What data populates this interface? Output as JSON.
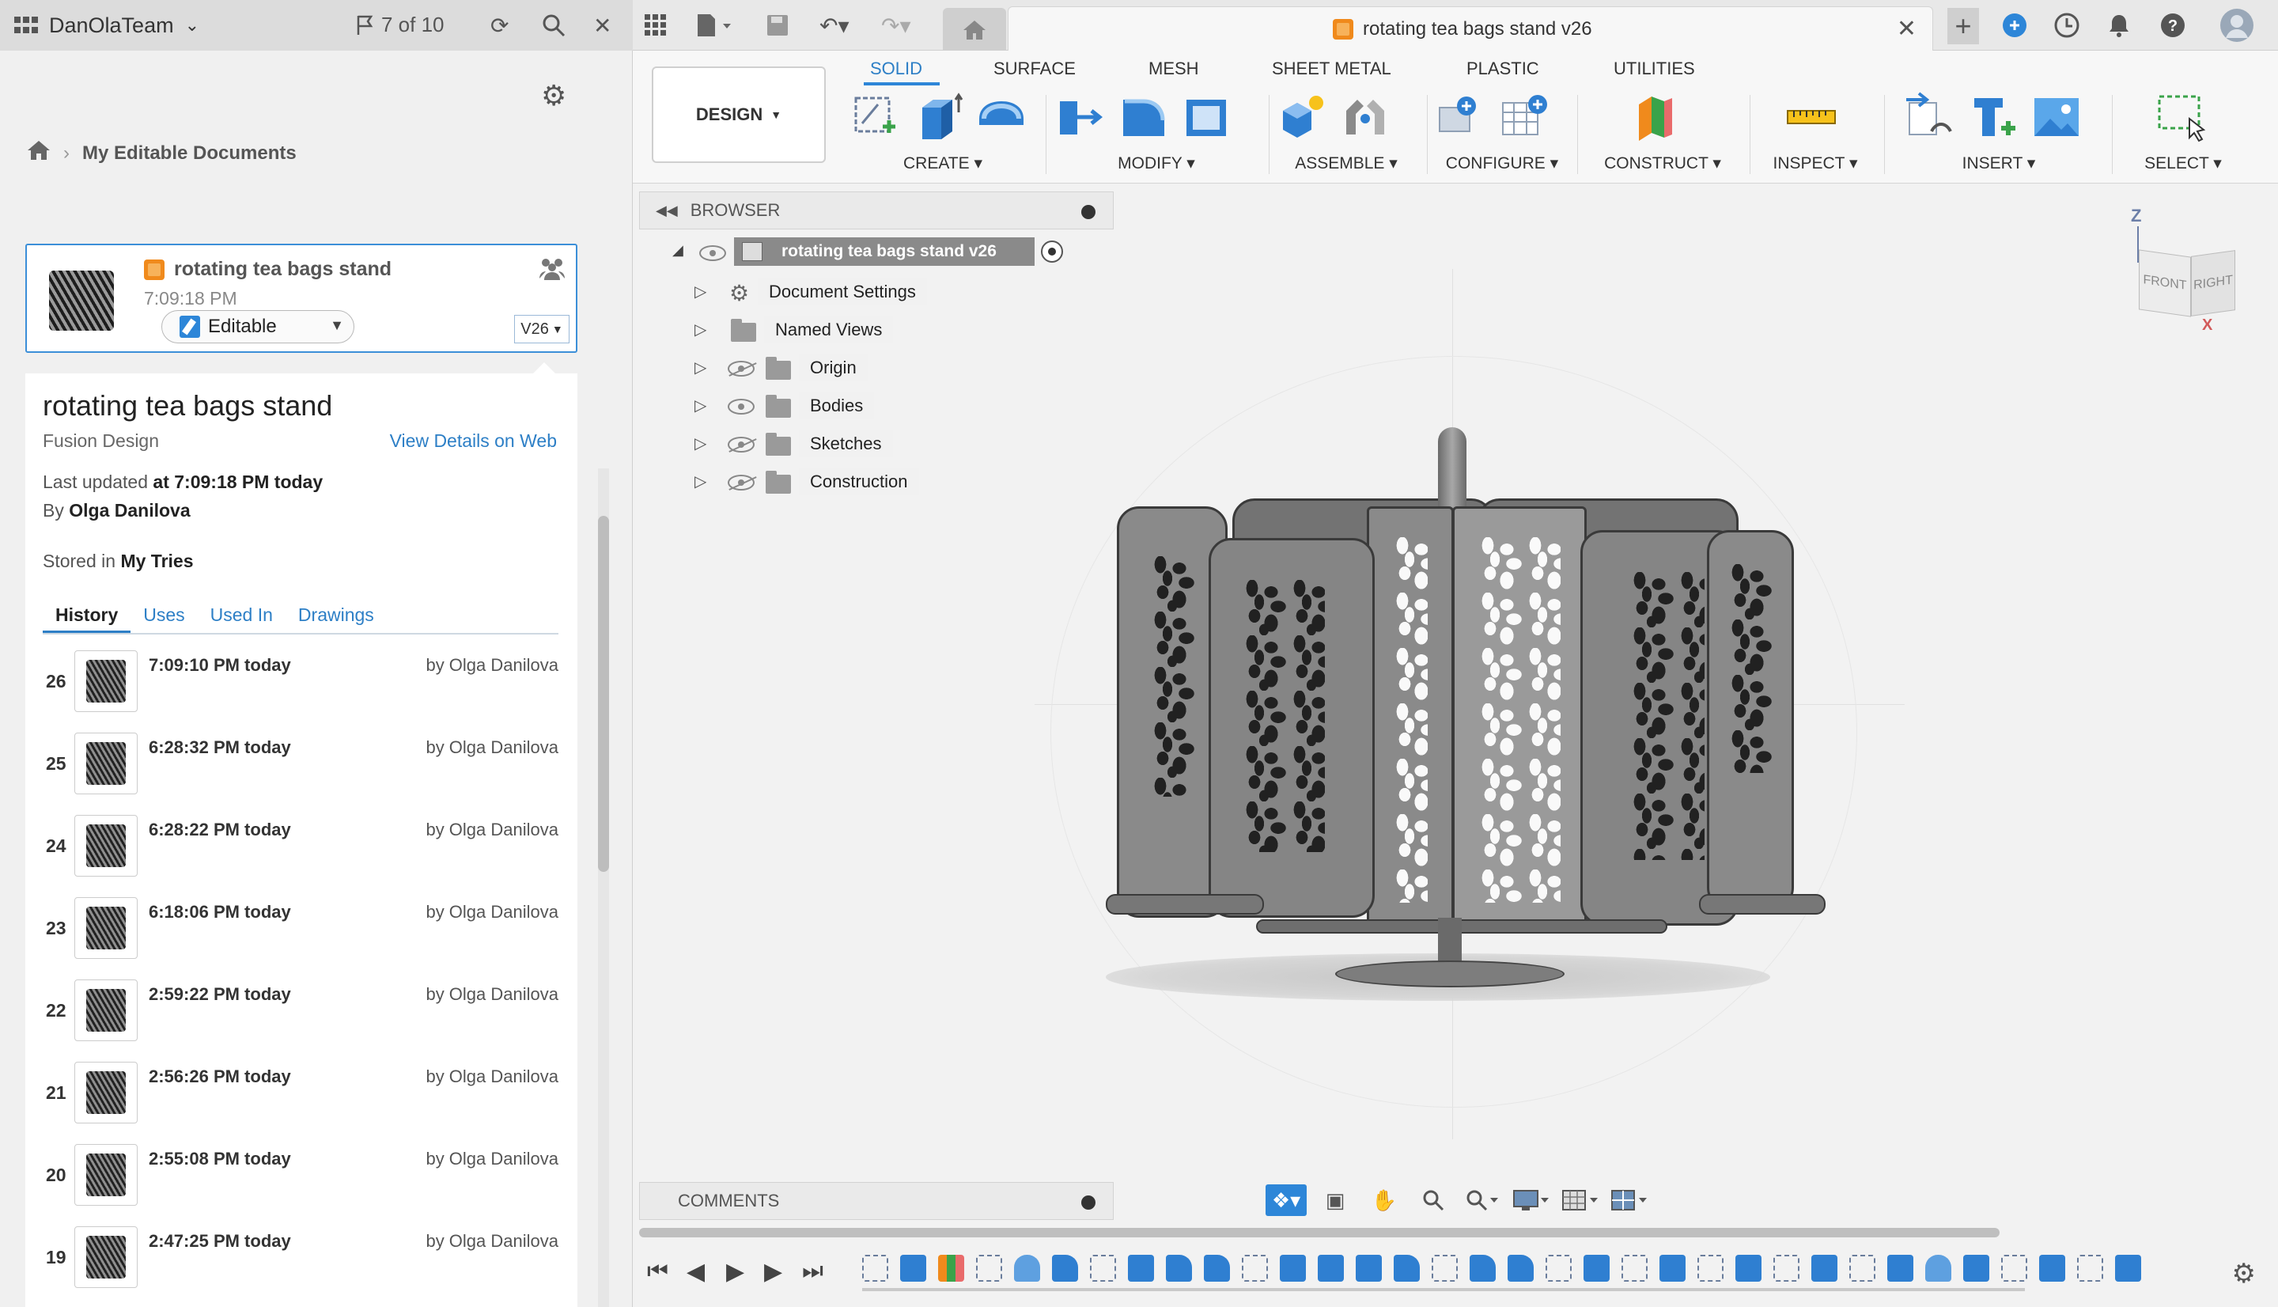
{
  "topbar": {
    "team_name": "DanOlaTeam",
    "jobs_label": "7 of 10",
    "document_tab_title": "rotating tea bags stand v26"
  },
  "data_panel": {
    "breadcrumb": "My Editable Documents",
    "card": {
      "name": "rotating tea bags stand",
      "time": "7:09:18 PM",
      "status": "Editable",
      "version": "V26"
    },
    "details": {
      "title": "rotating tea bags stand",
      "type": "Fusion Design",
      "link": "View Details on Web",
      "updated_prefix": "Last updated ",
      "updated_value": "at 7:09:18 PM today",
      "by_prefix": "By ",
      "by_value": "Olga Danilova",
      "stored_prefix": "Stored in ",
      "stored_value": "My Tries"
    },
    "tabs": [
      "History",
      "Uses",
      "Used In",
      "Drawings"
    ],
    "history": [
      {
        "version": "26",
        "time": "7:09:10 PM today",
        "by": "by Olga Danilova"
      },
      {
        "version": "25",
        "time": "6:28:32 PM today",
        "by": "by Olga Danilova"
      },
      {
        "version": "24",
        "time": "6:28:22 PM today",
        "by": "by Olga Danilova"
      },
      {
        "version": "23",
        "time": "6:18:06 PM today",
        "by": "by Olga Danilova"
      },
      {
        "version": "22",
        "time": "2:59:22 PM today",
        "by": "by Olga Danilova"
      },
      {
        "version": "21",
        "time": "2:56:26 PM today",
        "by": "by Olga Danilova"
      },
      {
        "version": "20",
        "time": "2:55:08 PM today",
        "by": "by Olga Danilova"
      },
      {
        "version": "19",
        "time": "2:47:25 PM today",
        "by": "by Olga Danilova"
      }
    ]
  },
  "toolbar": {
    "workspace": "DESIGN",
    "tabs": [
      "SOLID",
      "SURFACE",
      "MESH",
      "SHEET METAL",
      "PLASTIC",
      "UTILITIES"
    ],
    "groups": [
      "CREATE",
      "MODIFY",
      "ASSEMBLE",
      "CONFIGURE",
      "CONSTRUCT",
      "INSPECT",
      "INSERT",
      "SELECT"
    ]
  },
  "browser": {
    "header": "BROWSER",
    "root": "rotating tea bags stand v26",
    "items": [
      "Document Settings",
      "Named Views",
      "Origin",
      "Bodies",
      "Sketches",
      "Construction"
    ]
  },
  "viewcube": {
    "z": "Z",
    "x": "X",
    "front": "FRONT",
    "right": "RIGHT"
  },
  "comments": {
    "label": "COMMENTS"
  },
  "colors": {
    "accent": "#2d86d8",
    "brand_orange": "#f08a1c",
    "model_gray": "#8a8a8a"
  }
}
